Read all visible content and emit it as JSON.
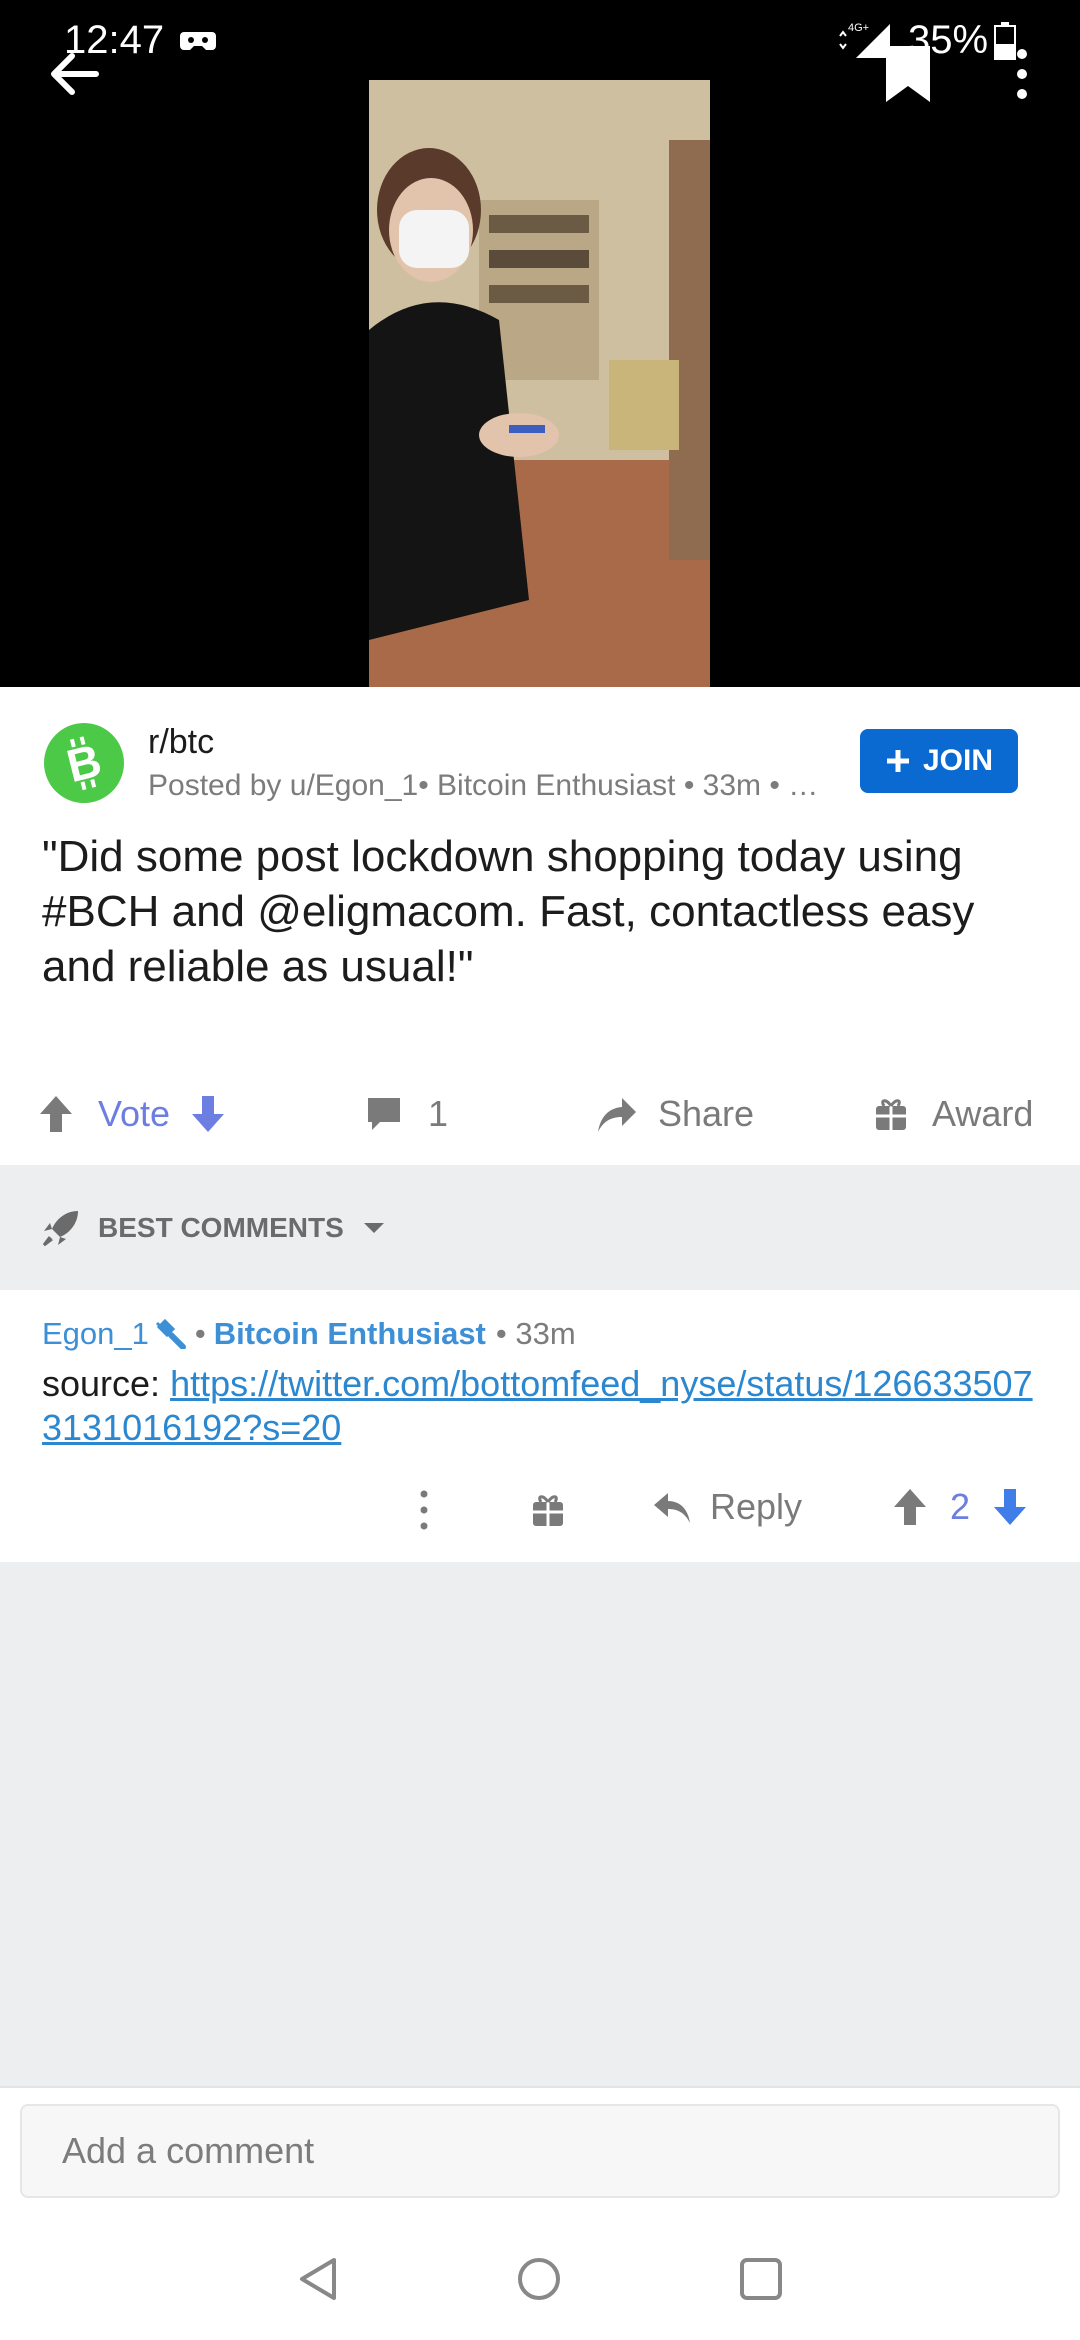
{
  "status_bar": {
    "time": "12:47",
    "network": "4G+",
    "battery": "35%"
  },
  "post": {
    "subreddit": "r/btc",
    "meta": "Posted by u/Egon_1• Bitcoin Enthusiast • 33m • …",
    "join_label": "JOIN",
    "title": "\"Did some post lockdown shopping today using #BCH and @eligmacom. Fast, contactless easy and reliable as usual!\"",
    "vote_label": "Vote",
    "comment_count": "1",
    "share_label": "Share",
    "award_label": "Award"
  },
  "sort": {
    "label": "BEST COMMENTS"
  },
  "comment": {
    "author": "Egon_1",
    "flair": "Bitcoin Enthusiast",
    "time": "• 33m",
    "body_prefix": "source: ",
    "link": "https://twitter.com/bottomfeed_nyse/status/1266335073131016192?s=20",
    "reply_label": "Reply",
    "score": "2"
  },
  "composer": {
    "placeholder": "Add a comment"
  },
  "colors": {
    "accent_blue": "#0a6ad1",
    "vote_blue": "#6c7ee1",
    "link_blue": "#2a87d0",
    "subreddit_green": "#4cc947"
  },
  "icons": [
    "back-arrow-icon",
    "bookmark-icon",
    "more-vertical-icon",
    "bitcoin-icon",
    "plus-icon",
    "upvote-icon",
    "downvote-icon",
    "comment-icon",
    "share-icon",
    "award-icon",
    "rocket-icon",
    "caret-down-icon",
    "moderator-icon",
    "reply-icon"
  ]
}
